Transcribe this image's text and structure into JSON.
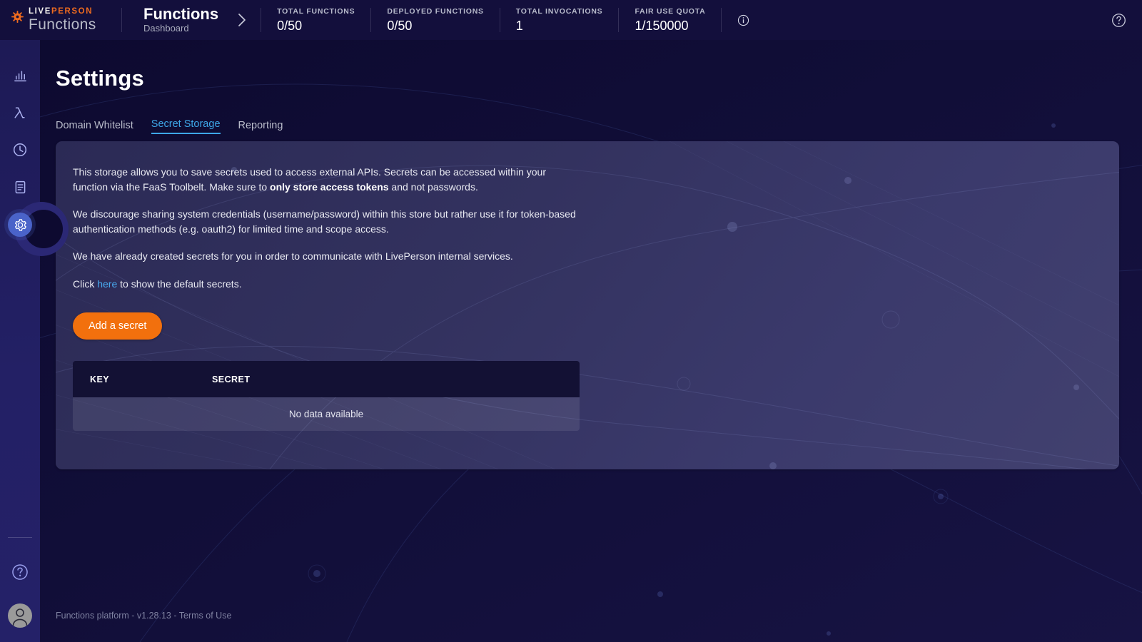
{
  "brand": {
    "logo_top_live": "LIVE",
    "logo_top_person": "PERSON",
    "logo_bottom": "Functions",
    "gear_icon": "gear-icon"
  },
  "header": {
    "breadcrumb_title": "Functions",
    "breadcrumb_subtitle": "Dashboard",
    "chevron_icon": "chevron-right-icon",
    "info_icon": "info-icon",
    "help_icon": "help-circle-icon",
    "stats": [
      {
        "label": "TOTAL FUNCTIONS",
        "value": "0/50"
      },
      {
        "label": "DEPLOYED FUNCTIONS",
        "value": "0/50"
      },
      {
        "label": "TOTAL INVOCATIONS",
        "value": "1"
      },
      {
        "label": "FAIR USE QUOTA",
        "value": "1/150000"
      }
    ]
  },
  "sidebar": {
    "items": [
      {
        "name": "sidebar-item-dashboard",
        "icon": "bar-chart-icon",
        "active": false
      },
      {
        "name": "sidebar-item-functions",
        "icon": "lambda-icon",
        "active": false
      },
      {
        "name": "sidebar-item-invocations",
        "icon": "clock-icon",
        "active": false
      },
      {
        "name": "sidebar-item-logs",
        "icon": "document-icon",
        "active": false
      },
      {
        "name": "sidebar-item-settings",
        "icon": "gear-icon",
        "active": true
      }
    ],
    "help_icon": "help-circle-icon",
    "avatar_icon": "user-avatar-icon"
  },
  "main": {
    "title": "Settings",
    "tabs": [
      {
        "label": "Domain Whitelist",
        "active": false
      },
      {
        "label": "Secret Storage",
        "active": true
      },
      {
        "label": "Reporting",
        "active": false
      }
    ],
    "paragraphs": {
      "p1_a": "This storage allows you to save secrets used to access external APIs. Secrets can be accessed within your function via the FaaS Toolbelt. Make sure to ",
      "p1_bold": "only store access tokens",
      "p1_b": " and not passwords.",
      "p2": "We discourage sharing system credentials (username/password) within this store but rather use it for token-based authentication methods (e.g. oauth2) for limited time and scope access.",
      "p3": "We have already created secrets for you in order to communicate with LivePerson internal services.",
      "p4_a": "Click ",
      "p4_link": "here",
      "p4_b": " to show the default secrets."
    },
    "add_secret_button": "Add a secret",
    "table": {
      "columns": [
        "KEY",
        "SECRET"
      ],
      "rows": [],
      "empty_message": "No data available"
    }
  },
  "footer": {
    "text": "Functions platform - v1.28.13 - Terms of Use",
    "platform": "Functions platform",
    "version": "v1.28.13",
    "terms": "Terms of Use"
  },
  "colors": {
    "brand_orange": "#ef6b1f",
    "accent_blue": "#3ea7e8",
    "button_orange": "#f2700d",
    "topbar_navy": "#130f3c",
    "page_navy": "#0d0a30",
    "sidebar_navy": "#232065",
    "card_violet": "#3b3a6c",
    "table_header": "#131134"
  }
}
